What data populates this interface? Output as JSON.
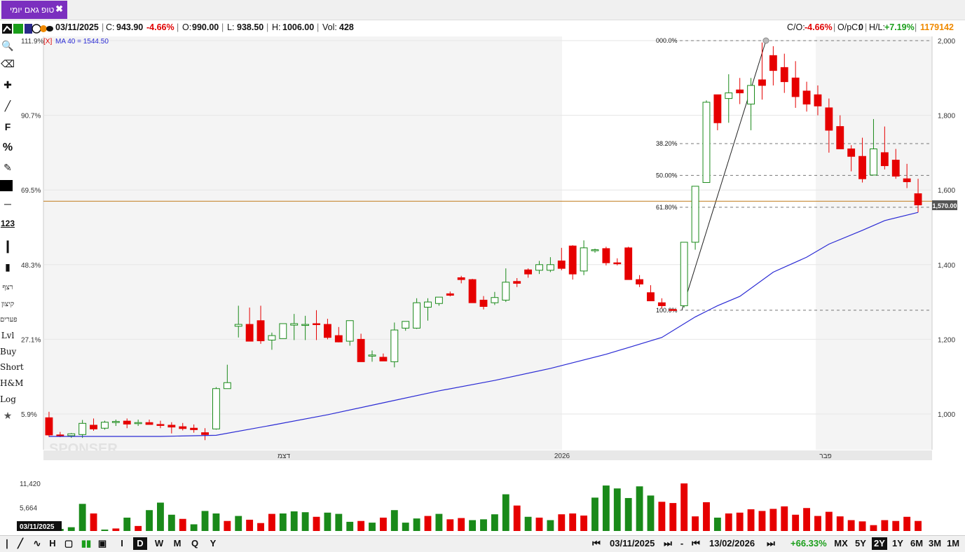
{
  "tab": {
    "title": "טופ גאם יומי",
    "close": "✖"
  },
  "info": {
    "date": "03/11/2025",
    "close_label": "C:",
    "close": "943.90",
    "change": "-4.66%",
    "open_label": "O:",
    "open": "990.00",
    "low_label": "L:",
    "low": "938.50",
    "high_label": "H:",
    "high": "1006.00",
    "vol_label": "Vol:",
    "vol": "428",
    "co_label": "C/O:",
    "co": "-4.66%",
    "opc_label": "O/pC:",
    "opc": "0",
    "hl_label": "H/L:",
    "hl": "+7.19%",
    "code": "1179142"
  },
  "ma_label": "[X]",
  "ma_text": "MA 40 = 1544.50",
  "tools": {
    "f": "F",
    "pct": "%",
    "n123": "123",
    "t1": "רצף",
    "t2": "קיצון",
    "t3": "פערים",
    "lvl": "Lvl",
    "buy": "Buy",
    "short": "Short",
    "hm": "H&M",
    "log": "Log"
  },
  "watermark": "SPONSER",
  "price_badge": "1,570.00",
  "vol_date": "03/11/2025",
  "fib": {
    "l0": "000.0%",
    "l38": "38.20%",
    "l50": "50.00%",
    "l61": "61.80%",
    "l100": "100.0%"
  },
  "bottom": {
    "interval": [
      "I",
      "D",
      "W",
      "M",
      "Q",
      "Y"
    ],
    "date1": "03/11/2025",
    "date2": "13/02/2026",
    "change": "+66.33%",
    "ranges": [
      "MX",
      "5Y",
      "2Y",
      "1Y",
      "6M",
      "3M",
      "1M"
    ],
    "selected_range": "2Y"
  },
  "chart_data": {
    "type": "candlestick",
    "y_right_ticks": [
      "1,000",
      "1,200",
      "1,400",
      "1,600",
      "1,800",
      "2,000"
    ],
    "y_right_values": [
      1000,
      1200,
      1400,
      1600,
      1800,
      2000
    ],
    "y_left_ticks": [
      "5.9%",
      "27.1%",
      "48.3%",
      "69.5%",
      "90.7%",
      "111.9%"
    ],
    "ylim": [
      925,
      2005
    ],
    "x_labels": [
      "דצמ",
      "2026",
      "פבר"
    ],
    "volume_ticks": [
      "5,664",
      "11,420"
    ],
    "volume_tick_values": [
      5664,
      11420
    ],
    "horizontal_line": 1570,
    "ma_name": "MA 40",
    "colors": {
      "up": "#1a8a1a",
      "down": "#e60000",
      "ma": "#2a2ad4",
      "hline": "#c07a1a"
    },
    "candles": [
      [
        990,
        1006,
        938.5,
        943.9
      ],
      [
        944,
        952,
        938,
        942
      ],
      [
        942,
        949,
        936,
        947
      ],
      [
        945,
        984,
        936,
        975
      ],
      [
        970,
        988,
        955,
        960
      ],
      [
        962,
        982,
        958,
        978
      ],
      [
        978,
        985,
        968,
        980
      ],
      [
        981,
        988,
        962,
        973
      ],
      [
        975,
        985,
        968,
        977
      ],
      [
        977,
        985,
        972,
        972
      ],
      [
        972,
        982,
        962,
        971
      ],
      [
        970,
        978,
        948,
        965
      ],
      [
        966,
        976,
        956,
        961
      ],
      [
        962,
        972,
        950,
        958
      ],
      [
        950,
        962,
        930,
        945
      ],
      [
        960,
        1072,
        958,
        1068
      ],
      [
        1068,
        1132,
        1082,
        1084
      ],
      [
        1235,
        1290,
        1205,
        1240
      ],
      [
        1240,
        1285,
        1195,
        1195
      ],
      [
        1250,
        1290,
        1188,
        1196
      ],
      [
        1198,
        1218,
        1172,
        1210
      ],
      [
        1202,
        1237,
        1202,
        1242
      ],
      [
        1238,
        1268,
        1198,
        1242
      ],
      [
        1240,
        1263,
        1198,
        1240
      ],
      [
        1242,
        1278,
        1198,
        1240
      ],
      [
        1240,
        1255,
        1200,
        1205
      ],
      [
        1210,
        1233,
        1192,
        1193
      ],
      [
        1195,
        1238,
        1183,
        1250
      ],
      [
        1200,
        1215,
        1142,
        1140
      ],
      [
        1155,
        1170,
        1140,
        1158
      ],
      [
        1152,
        1162,
        1146,
        1142
      ],
      [
        1140,
        1245,
        1125,
        1225
      ],
      [
        1230,
        1245,
        1223,
        1248
      ],
      [
        1230,
        1310,
        1228,
        1298
      ],
      [
        1286,
        1310,
        1250,
        1300
      ],
      [
        1296,
        1313,
        1290,
        1313
      ],
      [
        1322,
        1328,
        1315,
        1318
      ],
      [
        1365,
        1370,
        1350,
        1360
      ],
      [
        1360,
        1362,
        1320,
        1298
      ],
      [
        1305,
        1316,
        1280,
        1288
      ],
      [
        1298,
        1327,
        1292,
        1312
      ],
      [
        1305,
        1390,
        1300,
        1353
      ],
      [
        1355,
        1364,
        1340,
        1350
      ],
      [
        1386,
        1390,
        1365,
        1375
      ],
      [
        1385,
        1410,
        1375,
        1400
      ],
      [
        1385,
        1420,
        1380,
        1400
      ],
      [
        1410,
        1445,
        1385,
        1390
      ],
      [
        1450,
        1452,
        1360,
        1375
      ],
      [
        1383,
        1465,
        1372,
        1445
      ],
      [
        1440,
        1443,
        1432,
        1440
      ],
      [
        1443,
        1448,
        1398,
        1405
      ],
      [
        1405,
        1417,
        1398,
        1404
      ],
      [
        1445,
        1448,
        1365,
        1360
      ],
      [
        1360,
        1372,
        1340,
        1348
      ],
      [
        1325,
        1345,
        1310,
        1303
      ],
      [
        1298,
        1310,
        1283,
        1290
      ],
      [
        1280,
        1280,
        1278,
        1278
      ],
      [
        1290,
        1460,
        1285,
        1460
      ],
      [
        1460,
        1595,
        1440,
        1610
      ],
      [
        1620,
        1840,
        1640,
        1835
      ],
      [
        1855,
        1855,
        1760,
        1780
      ],
      [
        1845,
        1910,
        1780,
        1860
      ],
      [
        1868,
        1900,
        1830,
        1860
      ],
      [
        1830,
        1900,
        1760,
        1880
      ],
      [
        1895,
        1995,
        1842,
        1880
      ],
      [
        1960,
        1985,
        1880,
        1920
      ],
      [
        1928,
        1965,
        1860,
        1890
      ],
      [
        1900,
        1945,
        1820,
        1850
      ],
      [
        1865,
        1890,
        1810,
        1830
      ],
      [
        1855,
        1880,
        1800,
        1825
      ],
      [
        1820,
        1845,
        1700,
        1760
      ],
      [
        1770,
        1800,
        1720,
        1710
      ],
      [
        1710,
        1720,
        1650,
        1690
      ],
      [
        1690,
        1740,
        1620,
        1630
      ],
      [
        1640,
        1790,
        1640,
        1710
      ],
      [
        1700,
        1770,
        1655,
        1665
      ],
      [
        1680,
        1710,
        1630,
        1637
      ],
      [
        1630,
        1670,
        1605,
        1622
      ],
      [
        1590,
        1630,
        1540,
        1560
      ]
    ],
    "volumes": [
      300,
      500,
      900,
      6500,
      4200,
      300,
      600,
      3200,
      1200,
      5000,
      6800,
      3900,
      2900,
      1600,
      4800,
      4200,
      2400,
      3600,
      2700,
      1900,
      4100,
      4200,
      4700,
      4500,
      3400,
      4400,
      4100,
      2200,
      2400,
      2000,
      3200,
      5000,
      2000,
      3000,
      3600,
      4100,
      2800,
      3100,
      2600,
      2800,
      4000,
      8800,
      6100,
      3400,
      3200,
      2600,
      4000,
      4200,
      3700,
      8000,
      10900,
      10200,
      7900,
      10700,
      8500,
      7000,
      6700,
      11400,
      3500,
      6900,
      3200,
      4200,
      4400,
      5200,
      4800,
      5300,
      5900,
      3900,
      5500,
      3600,
      4600,
      3500,
      2600,
      2300,
      1400,
      2600,
      2400,
      3400,
      2400
    ],
    "volume_colors": [
      "red",
      "green",
      "green",
      "green",
      "red",
      "green",
      "red",
      "green",
      "red",
      "green",
      "green",
      "green",
      "red",
      "green",
      "green",
      "green",
      "red",
      "green",
      "red",
      "red",
      "red",
      "green",
      "green",
      "green",
      "red",
      "green",
      "green",
      "green",
      "red",
      "green",
      "red",
      "green",
      "green",
      "green",
      "red",
      "green",
      "red",
      "red",
      "green",
      "green",
      "green",
      "green",
      "red",
      "green",
      "red",
      "green",
      "red",
      "red",
      "red",
      "green",
      "green",
      "green",
      "green",
      "green",
      "green",
      "red",
      "red",
      "red",
      "red",
      "red",
      "green",
      "red",
      "red",
      "red",
      "red",
      "red",
      "red",
      "red",
      "red",
      "red",
      "red",
      "red",
      "red",
      "red",
      "red",
      "red",
      "red",
      "red",
      "red"
    ],
    "ma40": [
      [
        0,
        940
      ],
      [
        10,
        940
      ],
      [
        15,
        943
      ],
      [
        20,
        970
      ],
      [
        25,
        998
      ],
      [
        30,
        1030
      ],
      [
        35,
        1062
      ],
      [
        40,
        1090
      ],
      [
        45,
        1122
      ],
      [
        50,
        1160
      ],
      [
        55,
        1205
      ],
      [
        58,
        1260
      ],
      [
        60,
        1290
      ],
      [
        62,
        1315
      ],
      [
        65,
        1380
      ],
      [
        68,
        1420
      ],
      [
        70,
        1455
      ],
      [
        73,
        1492
      ],
      [
        75,
        1518
      ],
      [
        78,
        1540
      ]
    ],
    "fib_swing": {
      "low": 1278,
      "high": 2000
    }
  }
}
